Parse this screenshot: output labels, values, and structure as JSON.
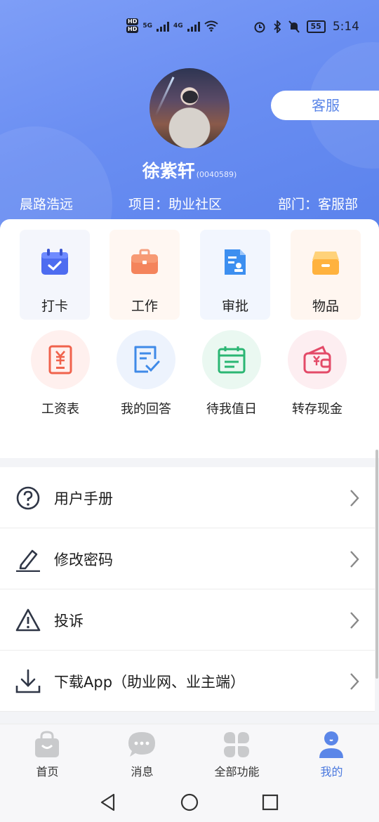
{
  "status_bar": {
    "time": "5:14",
    "battery": "55",
    "network_left": "HD",
    "net_5g": "5G",
    "net_4g": "4G"
  },
  "profile": {
    "name": "徐紫轩",
    "id": "(0040589)",
    "service_button": "客服"
  },
  "info": {
    "left": "晨路浩远",
    "project": "项目：助业社区",
    "department": "部门：客服部"
  },
  "quick_actions": [
    {
      "label": "打卡",
      "icon": "calendar-check-icon"
    },
    {
      "label": "工作",
      "icon": "briefcase-icon"
    },
    {
      "label": "审批",
      "icon": "document-stamp-icon"
    },
    {
      "label": "物品",
      "icon": "box-icon"
    }
  ],
  "secondary_actions": [
    {
      "label": "工资表",
      "icon": "salary-yen-icon"
    },
    {
      "label": "我的回答",
      "icon": "answer-check-icon"
    },
    {
      "label": "待我值日",
      "icon": "duty-calendar-icon"
    },
    {
      "label": "转存现金",
      "icon": "wallet-yen-icon"
    }
  ],
  "menu": [
    {
      "label": "用户手册",
      "icon": "question-circle-icon"
    },
    {
      "label": "修改密码",
      "icon": "pencil-icon"
    },
    {
      "label": "投诉",
      "icon": "warning-triangle-icon"
    },
    {
      "label": "下载App（助业网、业主端）",
      "icon": "download-icon"
    }
  ],
  "tabbar": [
    {
      "label": "首页",
      "icon": "shopping-bag-icon"
    },
    {
      "label": "消息",
      "icon": "chat-bubble-icon"
    },
    {
      "label": "全部功能",
      "icon": "grid-clover-icon"
    },
    {
      "label": "我的",
      "icon": "user-icon",
      "active": true
    }
  ],
  "colors": {
    "accent": "#4a78de",
    "header_start": "#7e9ef7",
    "header_end": "#5a82ec"
  }
}
